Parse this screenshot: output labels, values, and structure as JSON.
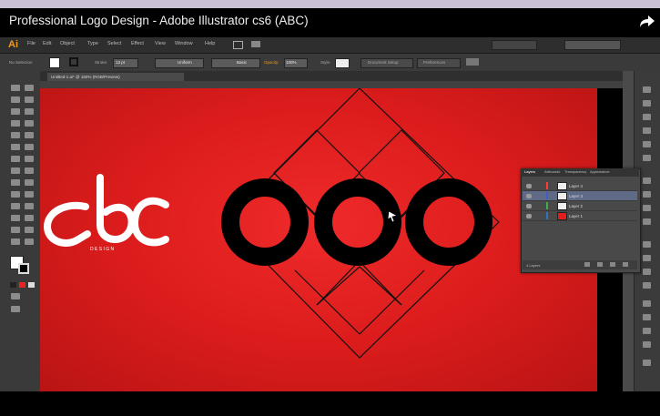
{
  "video": {
    "title": "Professional Logo Design - Adobe Illustrator cs6 (ABC)"
  },
  "app": {
    "logo": "Ai",
    "menu": [
      "File",
      "Edit",
      "Object",
      "Type",
      "Select",
      "Effect",
      "View",
      "Window",
      "Help"
    ],
    "control_bar": {
      "selection_label": "No Selection",
      "stroke_label": "Stroke:",
      "stroke_value": "13 pt",
      "uniform_label": "Uniform",
      "brush_label": "Basic",
      "opacity_label": "Opacity:",
      "opacity_value": "100%",
      "style_label": "Style:",
      "doc_setup": "Document Setup",
      "preferences": "Preferences"
    },
    "document_tab": "Untitled-1.ai* @ 150% (RGB/Preview)"
  },
  "artwork": {
    "logo_text": "abc",
    "logo_subtext": "D E S I G N",
    "canvas_color": "#e11d1d",
    "ring_color": "#000000"
  },
  "layers_panel": {
    "tabs": [
      "Layers",
      "Artboards",
      "Transparency",
      "Appearance"
    ],
    "rows": [
      {
        "name": "Layer 4",
        "color": "#ff3b3b",
        "selected": false
      },
      {
        "name": "Layer 3",
        "color": "#3f5ec8",
        "selected": true
      },
      {
        "name": "Layer 2",
        "color": "#37b24d",
        "selected": false
      },
      {
        "name": "Layer 1",
        "color": "#2a74c9",
        "selected": false
      }
    ],
    "footer": "4 Layers"
  },
  "colors": {
    "ui_dark": "#3a3a3a",
    "accent": "#f09a1c"
  }
}
